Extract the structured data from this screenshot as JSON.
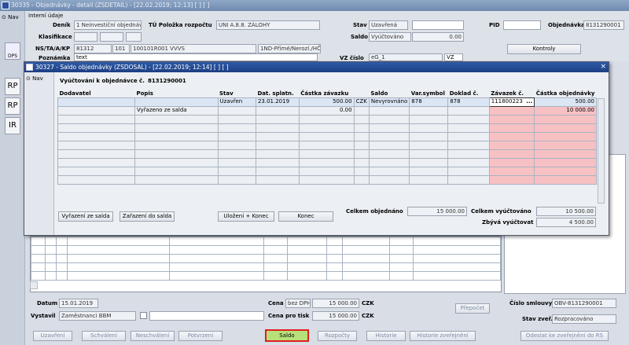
{
  "window": {
    "title": "30335 - Objednávky - detail (ZSDETAIL) - [22.02.2019; 12:13] [ ] [ ]"
  },
  "nav": {
    "label": "Nav"
  },
  "left_tools": [
    "DPS",
    "RP",
    "RP",
    "IR"
  ],
  "header": {
    "section": "Interní údaje",
    "denik_label": "Deník",
    "denik_value": "1 Neinvestiční objednávk",
    "tu_label": "TÚ Položka rozpočtu",
    "tu_value": "UNI A.8.8. ZÁLOHY",
    "stav_label": "Stav",
    "stav_value": "Uzavřená",
    "pid_label": "PID",
    "objednavka_label": "Objednávka",
    "objednavka_value": "8131290001",
    "klasifikace_label": "Klasifikace",
    "saldo_label": "Saldo",
    "saldo_value": "Vyúčtováno",
    "saldo_amount": "0.00",
    "nstakp_label": "NS/TA/A/KP",
    "ns_value": "81312",
    "ta_value": "101",
    "a_value": "100101R001 VVVS",
    "kp_value": "1ND-Přímé/Nerozl./HČ-",
    "poznamka_label": "Poznámka",
    "poznamka_value": "text",
    "vz_label": "VZ číslo",
    "vz_value": "eG_1",
    "vz_suffix": "VZ",
    "kontroly_label": "Kontroly"
  },
  "dialog": {
    "title": "30327 - Saldo objednávky (ZSDOSAL) - [22.02.2019; 12:14] [ ] [ ]",
    "close": "×",
    "nav_label": "Nav",
    "caption": "Vyúčtování k objednávce č.",
    "caption_value": "8131290001",
    "columns": [
      "Dodavatel",
      "Popis",
      "Stav",
      "Dat. splatn.",
      "Částka závazku",
      "Saldo",
      "Var.symbol",
      "Doklad č.",
      "Závazek č.",
      "Částka objednávky"
    ],
    "rows": [
      {
        "dodavatel": "",
        "popis": "",
        "stav": "Uzavřen",
        "datum": "23.01.2019",
        "castka": "500.00",
        "mena": "CZK",
        "saldo": "Nevyrovnáno",
        "varsym": "878",
        "doklad": "878",
        "zavazek": "111800223",
        "zavazek_btn": "...",
        "castka_obj": "500.00"
      },
      {
        "dodavatel": "",
        "popis": "Vyřazeno ze salda",
        "stav": "",
        "datum": "",
        "castka": "0.00",
        "mena": "",
        "saldo": "",
        "varsym": "",
        "doklad": "",
        "zavazek": "",
        "zavazek_btn": "",
        "castka_obj": "10 000.00"
      }
    ],
    "buttons": {
      "vyrazeni": "Vyřazení ze salda",
      "zarazeni": "Zařazení do salda",
      "ulozeni": "Uložení + Konec",
      "konec": "Konec"
    },
    "totals": {
      "celkem_obj_label": "Celkem objednáno",
      "celkem_obj_value": "15 000.00",
      "celkem_vyuct_label": "Celkem vyúčtováno",
      "celkem_vyuct_value": "10 500.00",
      "zbyva_label": "Zbývá vyúčtovat",
      "zbyva_value": "4 500.00"
    }
  },
  "bottom": {
    "datum_label": "Datum",
    "datum_value": "15.01.2019",
    "vystavil_label": "Vystavil",
    "vystavil_value": "Zaměstnanci BBM",
    "cena_label": "Cena",
    "cena_type": "bez DPH",
    "cena_value": "15 000.00",
    "cena_currency": "CZK",
    "cena_tisk_label": "Cena pro tisk",
    "cena_tisk_value": "15 000.00",
    "cena_tisk_currency": "CZK",
    "prepocet_label": "Přepočet",
    "cislo_smlouvy_label": "Číslo smlouvy",
    "cislo_smlouvy_value": "OBV-8131290001",
    "stav_zver_label": "Stav zveř.",
    "stav_zver_value": "Rozpracováno"
  },
  "footer_buttons": [
    "Uzavření",
    "Schválení",
    "Neschválení",
    "Potvrzení",
    "Saldo",
    "Rozpočty",
    "Historie",
    "Historie zveřejnění",
    "Odeslat ke zveřejnění do RS"
  ],
  "colors": {
    "dialog_title": "#2d5aa8",
    "window_title": "#7b95b8",
    "highlight_border": "#e0201c",
    "saldo_button": "#b8e07a",
    "pink_cell": "#f7c1c4"
  }
}
